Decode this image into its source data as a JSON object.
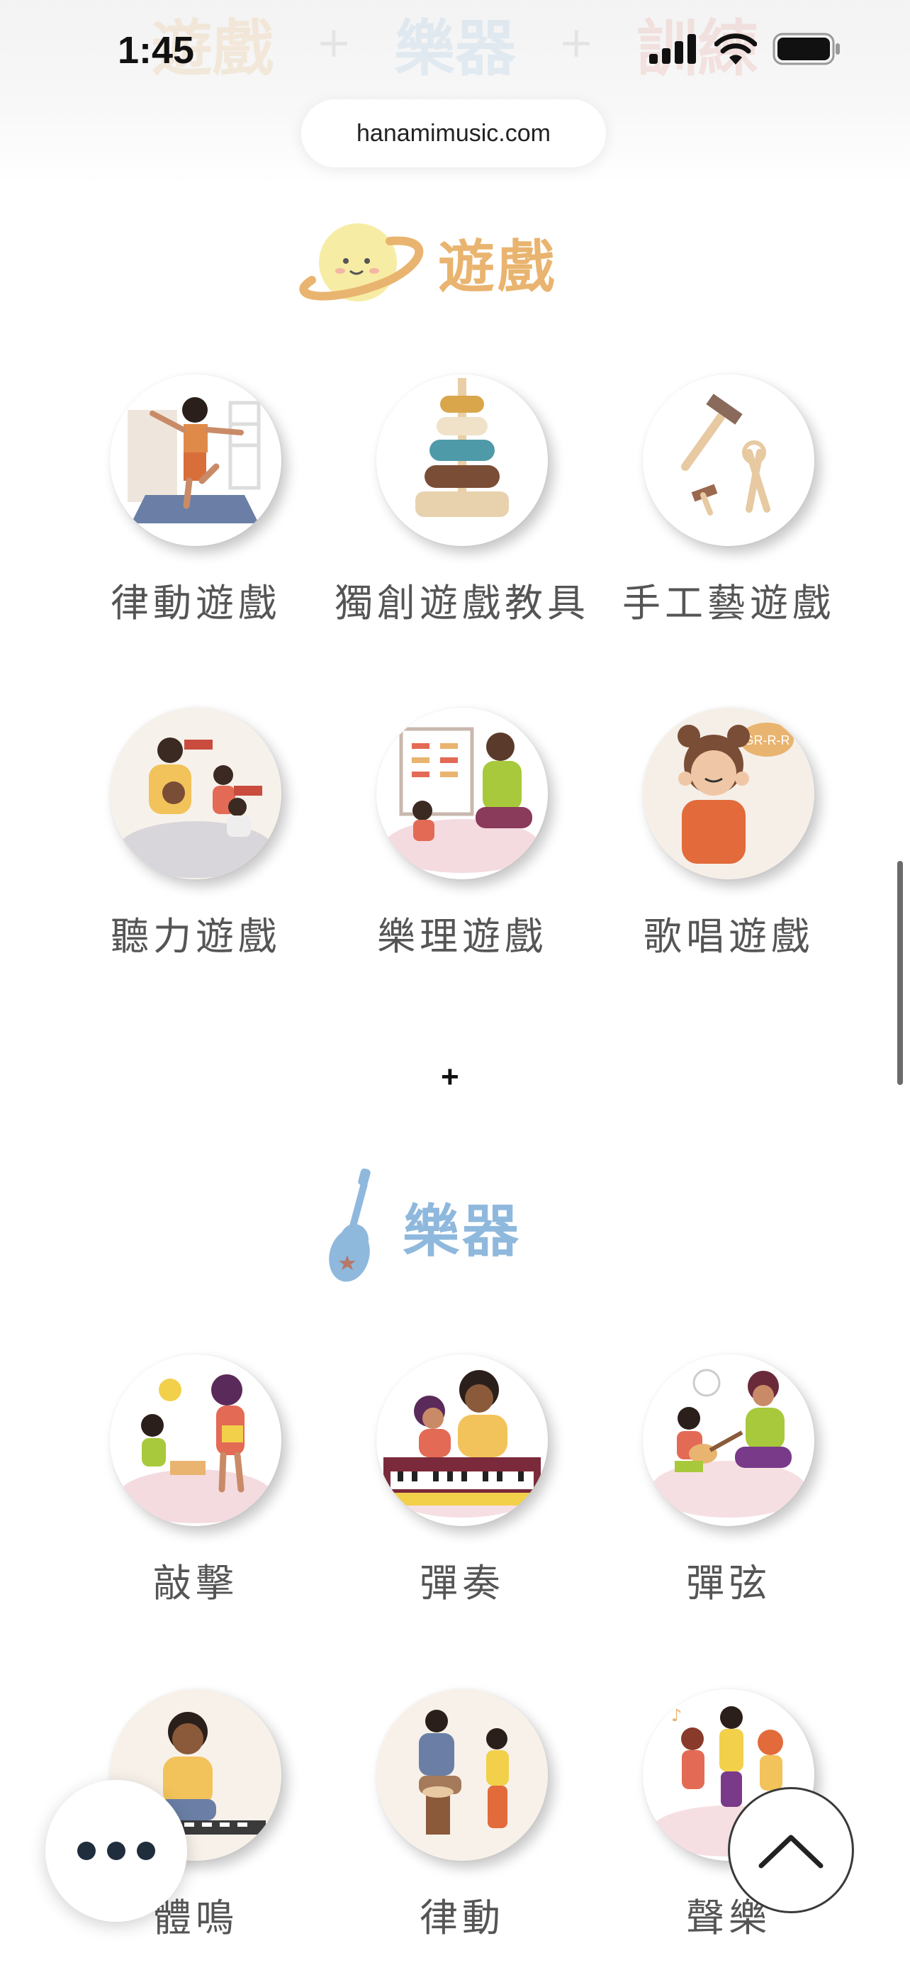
{
  "status_bar": {
    "time": "1:45"
  },
  "ghost_title": {
    "word1": "遊戲",
    "word2": "樂器",
    "word3": "訓練",
    "sep": "+"
  },
  "browser": {
    "url": "hanamimusic.com"
  },
  "sections": {
    "games": {
      "title": "遊戲",
      "items": [
        {
          "label": "律動遊戲"
        },
        {
          "label": "獨創遊戲教具"
        },
        {
          "label": "手工藝遊戲"
        },
        {
          "label": "聽力遊戲"
        },
        {
          "label": "樂理遊戲"
        },
        {
          "label": "歌唱遊戲"
        }
      ]
    },
    "separator": "+",
    "instruments": {
      "title": "樂器",
      "items": [
        {
          "label": "敲擊"
        },
        {
          "label": "彈奏"
        },
        {
          "label": "彈弦"
        },
        {
          "label": "體鳴"
        },
        {
          "label": "律動"
        },
        {
          "label": "聲樂"
        }
      ]
    }
  },
  "illustration_text": {
    "bear_speech": "GR-R-R"
  },
  "colors": {
    "games_accent": "#e9b46f",
    "instruments_accent": "#8fb8dd",
    "label_text": "#555555"
  },
  "icons": [
    "signal-icon",
    "wifi-icon",
    "battery-icon",
    "planet-icon",
    "ukulele-icon",
    "more-icon",
    "chevron-up-icon"
  ]
}
